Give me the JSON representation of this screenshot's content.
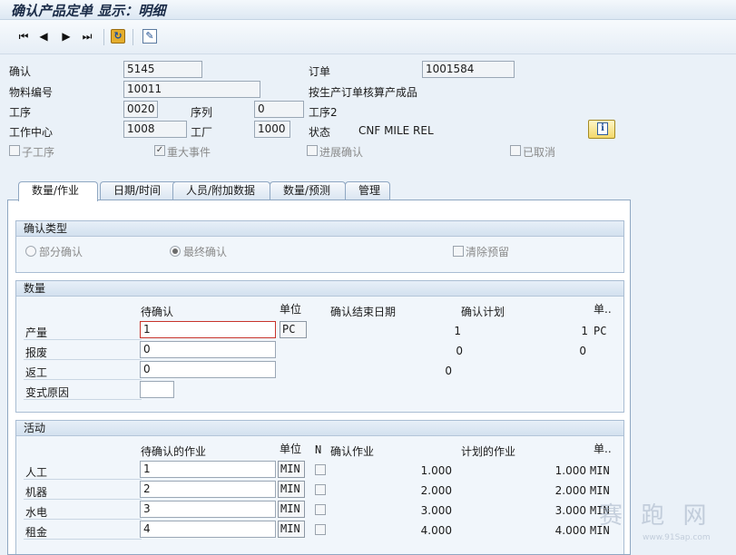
{
  "window": {
    "title": "确认产品定单 显示：明细"
  },
  "toolbar": {
    "first": "⏮",
    "prev": "◀",
    "next": "▶",
    "last": "⏭",
    "save_icon": "↻",
    "edit_icon": "✎"
  },
  "header": {
    "confirm_label": "确认",
    "confirm_value": "5145",
    "order_label": "订单",
    "order_value": "1001584",
    "material_label": "物料编号",
    "material_value": "10011",
    "costing_note": "按生产订单核算产成品",
    "operation_label": "工序",
    "operation_value": "0020",
    "sequence_label": "序列",
    "sequence_value": "0",
    "operation_text": "工序2",
    "workcenter_label": "工作中心",
    "workcenter_value": "1008",
    "plant_label": "工厂",
    "plant_value": "1000",
    "status_label": "状态",
    "status_value": "CNF  MILE REL",
    "info_icon": "i"
  },
  "flags": {
    "sub_operation": "子工序",
    "sub_operation_checked": false,
    "milestone": "重大事件",
    "milestone_checked": true,
    "progress_confirm": "进展确认",
    "progress_confirm_checked": false,
    "cancelled": "已取消",
    "cancelled_checked": false
  },
  "tabs": [
    {
      "label": "数量/作业",
      "active": true
    },
    {
      "label": "日期/时间",
      "active": false
    },
    {
      "label": "人员/附加数据",
      "active": false
    },
    {
      "label": "数量/预测",
      "active": false
    },
    {
      "label": "管理",
      "active": false
    }
  ],
  "confirm_type": {
    "title": "确认类型",
    "partial": "部分确认",
    "final": "最终确认",
    "clear_reservations": "清除预留",
    "selected": "final"
  },
  "quantities": {
    "title": "数量",
    "col_pending": "待确认",
    "col_unit": "单位",
    "col_end_date": "确认结束日期",
    "col_plan": "确认计划",
    "col_unit2": "单..",
    "rows": [
      {
        "label": "产量",
        "value": "1",
        "unit": "PC",
        "end_date": "1",
        "plan": "1",
        "plan_unit": "PC"
      },
      {
        "label": "报废",
        "value": "0",
        "unit": "",
        "end_date": "0",
        "plan": "0",
        "plan_unit": ""
      },
      {
        "label": "返工",
        "value": "0",
        "unit": "",
        "end_date": "0",
        "plan": "",
        "plan_unit": ""
      },
      {
        "label": "变式原因",
        "value": "",
        "unit": "",
        "end_date": "",
        "plan": "",
        "plan_unit": ""
      }
    ]
  },
  "activities": {
    "title": "活动",
    "col_pending": "待确认的作业",
    "col_unit": "单位",
    "col_n": "N",
    "col_confirm": "确认作业",
    "col_planned": "计划的作业",
    "col_unit2": "单..",
    "rows": [
      {
        "label": "人工",
        "value": "1",
        "unit": "MIN",
        "confirm": "1.000",
        "planned": "1.000",
        "planned_unit": "MIN"
      },
      {
        "label": "机器",
        "value": "2",
        "unit": "MIN",
        "confirm": "2.000",
        "planned": "2.000",
        "planned_unit": "MIN"
      },
      {
        "label": "水电",
        "value": "3",
        "unit": "MIN",
        "confirm": "3.000",
        "planned": "3.000",
        "planned_unit": "MIN"
      },
      {
        "label": "租金",
        "value": "4",
        "unit": "MIN",
        "confirm": "4.000",
        "planned": "4.000",
        "planned_unit": "MIN"
      }
    ]
  },
  "watermark": {
    "text": "赛 跑 网",
    "url": "www.91Sap.com"
  }
}
